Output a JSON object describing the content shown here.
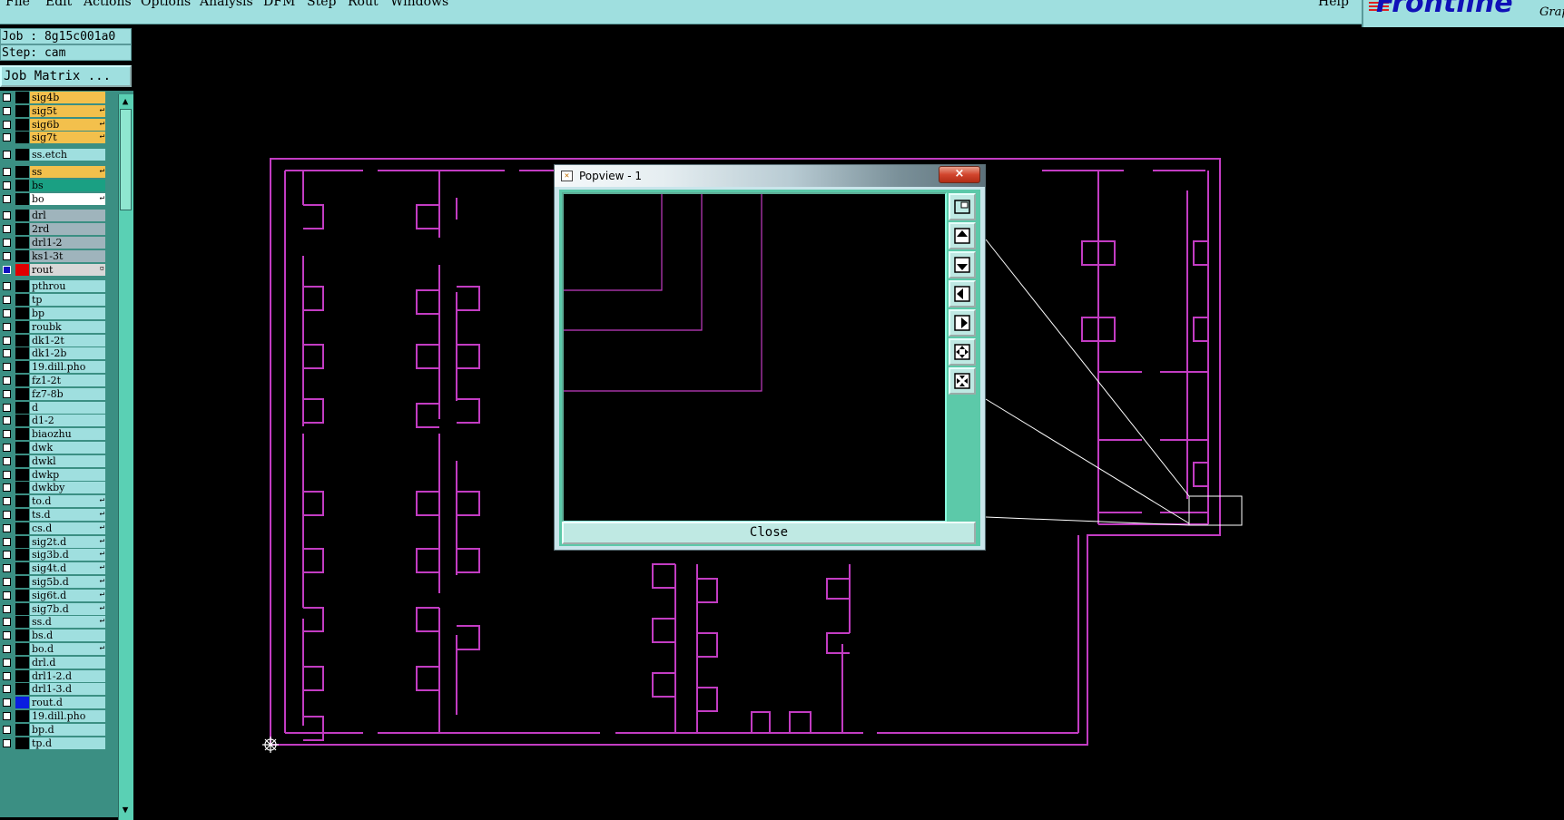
{
  "menu": {
    "items": [
      "File",
      "Edit",
      "Actions",
      "Options",
      "Analysis",
      "DFM",
      "Step",
      "Rout",
      "Windows"
    ],
    "help": "Help"
  },
  "logo": {
    "text": "Frontline",
    "sub": "Grap"
  },
  "job": {
    "label": "Job : 8g15c001a0",
    "step": "Step: cam",
    "matrix_button": "Job Matrix ..."
  },
  "layers": [
    {
      "name": "sig4b",
      "color": "#f3c04c",
      "flag": ""
    },
    {
      "name": "sig5t",
      "color": "#f3c04c",
      "flag": "↵"
    },
    {
      "name": "sig6b",
      "color": "#f3c04c",
      "flag": "↵"
    },
    {
      "name": "sig7t",
      "color": "#f3c04c",
      "flag": "↵"
    },
    {
      "name": "ss.etch",
      "color": "#9fdfdf",
      "flag": ""
    },
    {
      "name": "ss",
      "color": "#f3c04c",
      "flag": "↵"
    },
    {
      "name": "bs",
      "color": "#1aa083",
      "flag": ""
    },
    {
      "name": "bo",
      "color": "#ffffff",
      "flag": "↵"
    },
    {
      "name": "drl",
      "color": "#9fb4bc",
      "flag": ""
    },
    {
      "name": "2rd",
      "color": "#9fb4bc",
      "flag": ""
    },
    {
      "name": "drl1-2",
      "color": "#9fb4bc",
      "flag": ""
    },
    {
      "name": "ks1-3t",
      "color": "#9fb4bc",
      "flag": ""
    },
    {
      "name": "rout",
      "color": "#d8d8d8",
      "flag": "▫"
    },
    {
      "name": "pthrou",
      "color": "#9fdfdf",
      "flag": ""
    },
    {
      "name": "tp",
      "color": "#9fdfdf",
      "flag": ""
    },
    {
      "name": "bp",
      "color": "#9fdfdf",
      "flag": ""
    },
    {
      "name": "roubk",
      "color": "#9fdfdf",
      "flag": ""
    },
    {
      "name": "dk1-2t",
      "color": "#9fdfdf",
      "flag": ""
    },
    {
      "name": "dk1-2b",
      "color": "#9fdfdf",
      "flag": ""
    },
    {
      "name": "19.dill.pho",
      "color": "#9fdfdf",
      "flag": ""
    },
    {
      "name": "fz1-2t",
      "color": "#9fdfdf",
      "flag": ""
    },
    {
      "name": "fz7-8b",
      "color": "#9fdfdf",
      "flag": ""
    },
    {
      "name": "d",
      "color": "#9fdfdf",
      "flag": ""
    },
    {
      "name": "d1-2",
      "color": "#9fdfdf",
      "flag": ""
    },
    {
      "name": "biaozhu",
      "color": "#9fdfdf",
      "flag": ""
    },
    {
      "name": "dwk",
      "color": "#9fdfdf",
      "flag": ""
    },
    {
      "name": "dwkl",
      "color": "#9fdfdf",
      "flag": ""
    },
    {
      "name": "dwkp",
      "color": "#9fdfdf",
      "flag": ""
    },
    {
      "name": "dwkby",
      "color": "#9fdfdf",
      "flag": ""
    },
    {
      "name": "to.d",
      "color": "#9fdfdf",
      "flag": "↵"
    },
    {
      "name": "ts.d",
      "color": "#9fdfdf",
      "flag": "↵"
    },
    {
      "name": "cs.d",
      "color": "#9fdfdf",
      "flag": "↵"
    },
    {
      "name": "sig2t.d",
      "color": "#9fdfdf",
      "flag": "↵"
    },
    {
      "name": "sig3b.d",
      "color": "#9fdfdf",
      "flag": "↵"
    },
    {
      "name": "sig4t.d",
      "color": "#9fdfdf",
      "flag": "↵"
    },
    {
      "name": "sig5b.d",
      "color": "#9fdfdf",
      "flag": "↵"
    },
    {
      "name": "sig6t.d",
      "color": "#9fdfdf",
      "flag": "↵"
    },
    {
      "name": "sig7b.d",
      "color": "#9fdfdf",
      "flag": "↵"
    },
    {
      "name": "ss.d",
      "color": "#9fdfdf",
      "flag": "↵"
    },
    {
      "name": "bs.d",
      "color": "#9fdfdf",
      "flag": ""
    },
    {
      "name": "bo.d",
      "color": "#9fdfdf",
      "flag": "↵"
    },
    {
      "name": "drl.d",
      "color": "#9fdfdf",
      "flag": ""
    },
    {
      "name": "drl1-2.d",
      "color": "#9fdfdf",
      "flag": ""
    },
    {
      "name": "drl1-3.d",
      "color": "#9fdfdf",
      "flag": ""
    },
    {
      "name": "rout.d",
      "color": "#9fdfdf",
      "flag": ""
    },
    {
      "name": "19.dill.pho",
      "color": "#9fdfdf",
      "flag": ""
    },
    {
      "name": "bp.d",
      "color": "#9fdfdf",
      "flag": ""
    },
    {
      "name": "tp.d",
      "color": "#9fdfdf",
      "flag": ""
    }
  ],
  "colors": {
    "board_outline": "#c23cc2",
    "rout_swatch": "#e00000",
    "rout_check": "#1010c0",
    "routd_swatch": "#0a1ee0",
    "accent": "#9fdfdf"
  },
  "popview": {
    "title": "Popview - 1",
    "close_x": "×",
    "close_label": "Close"
  }
}
